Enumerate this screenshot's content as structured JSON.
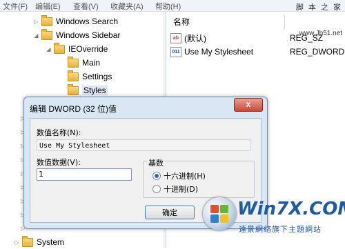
{
  "menubar": {
    "items": [
      "文件(F)",
      "编辑(E)",
      "查看(V)",
      "收藏夹(A)",
      "帮助(H)"
    ]
  },
  "watermark": {
    "top_text": "脚 本 之 家",
    "url": "www.Jb51.net"
  },
  "tree": {
    "items": [
      {
        "label": "Windows Search",
        "expander": "▷"
      },
      {
        "label": "Windows Sidebar",
        "expander": "◢"
      },
      {
        "label": "IEOverride",
        "expander": "◢"
      },
      {
        "label": "Main",
        "expander": ""
      },
      {
        "label": "Settings",
        "expander": ""
      },
      {
        "label": "Styles",
        "expander": ""
      },
      {
        "label": "System",
        "expander": "▷"
      }
    ],
    "side_expanders": [
      "▷",
      "▷",
      "▷",
      "▷",
      "▷",
      "▷",
      "▷",
      "▷",
      "▷"
    ]
  },
  "values": {
    "col_name": "名称",
    "rows": [
      {
        "name": "(默认)",
        "type": "REG_SZ",
        "icon": "ab"
      },
      {
        "name": "Use My Stylesheet",
        "type": "REG_DWORD",
        "icon": "011"
      }
    ]
  },
  "dialog": {
    "title": "编辑 DWORD (32 位)值",
    "close_label": "x",
    "name_label": "数值名称(N):",
    "name_value": "Use My Stylesheet",
    "data_label": "数值数据(V):",
    "data_value": "1",
    "base_label": "基数",
    "radio_hex": "十六进制(H)",
    "radio_dec": "十进制(D)",
    "hex_selected": true,
    "ok_label": "确定"
  },
  "logo": {
    "title": "Win7X.COM",
    "subtitle": "遠景網絡旗下主題網站"
  }
}
